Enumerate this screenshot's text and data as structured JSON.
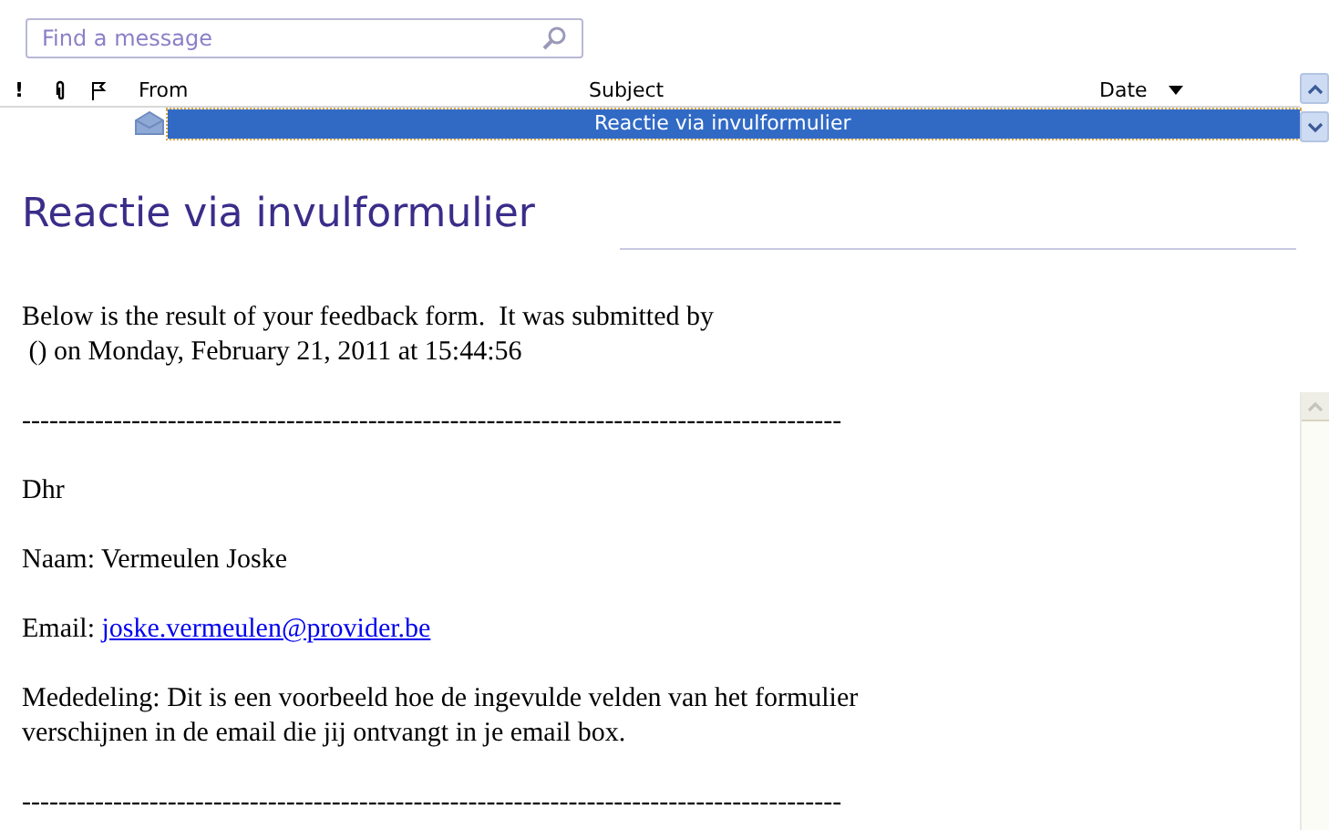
{
  "search": {
    "placeholder": "Find a message"
  },
  "columns": [
    {
      "kind": "importance",
      "label": "!"
    },
    {
      "kind": "attachment"
    },
    {
      "kind": "flag"
    },
    {
      "kind": "from",
      "label": "From"
    },
    {
      "kind": "subject",
      "label": "Subject"
    },
    {
      "kind": "date",
      "label": "Date",
      "sorted": true
    }
  ],
  "messages": [
    {
      "subject": "Reactie via invulformulier",
      "selected": true
    }
  ],
  "message": {
    "title": "Reactie via invulformulier",
    "body": [
      {
        "kind": "text",
        "lines": [
          "Below is the result of your feedback form.  It was submitted by",
          " () on Monday, February 21, 2011 at 15:44:56"
        ]
      },
      {
        "kind": "rule",
        "text": "------------------------------------------------------------------------------------------"
      },
      {
        "kind": "text",
        "lines": [
          "Dhr"
        ]
      },
      {
        "kind": "text",
        "lines": [
          "Naam: Vermeulen Joske"
        ]
      },
      {
        "kind": "link",
        "label": "Email:",
        "link": "joske.vermeulen@provider.be"
      },
      {
        "kind": "text",
        "lines": [
          "Mededeling: Dit is een voorbeeld hoe de ingevulde velden van het formulier",
          "verschijnen in de email die jij ontvangt in je email box."
        ]
      },
      {
        "kind": "rule",
        "text": "------------------------------------------------------------------------------------------"
      }
    ]
  }
}
